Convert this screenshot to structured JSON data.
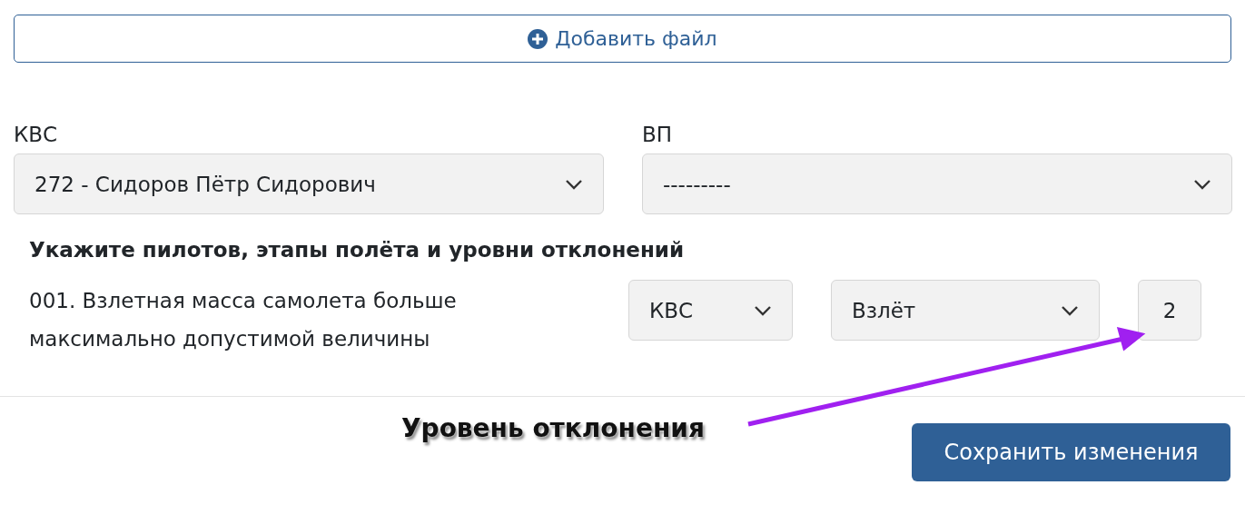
{
  "add_file_button": {
    "label": "Добавить файл"
  },
  "crew_fields": [
    {
      "label": "КВС",
      "value": "272 - Сидоров Пётр Сидорович"
    },
    {
      "label": "ВП",
      "value": "---------"
    }
  ],
  "deviations_heading": "Укажите пилотов, этапы полёта и уровни отклонений",
  "deviations": [
    {
      "text": "001. Взлетная масса самолета больше максимально допустимой величины",
      "pilot": "КВС",
      "stage": "Взлёт",
      "level_value": "2"
    }
  ],
  "annotation": {
    "text": "Уровень отклонения"
  },
  "save_button": {
    "label": "Сохранить изменения"
  }
}
